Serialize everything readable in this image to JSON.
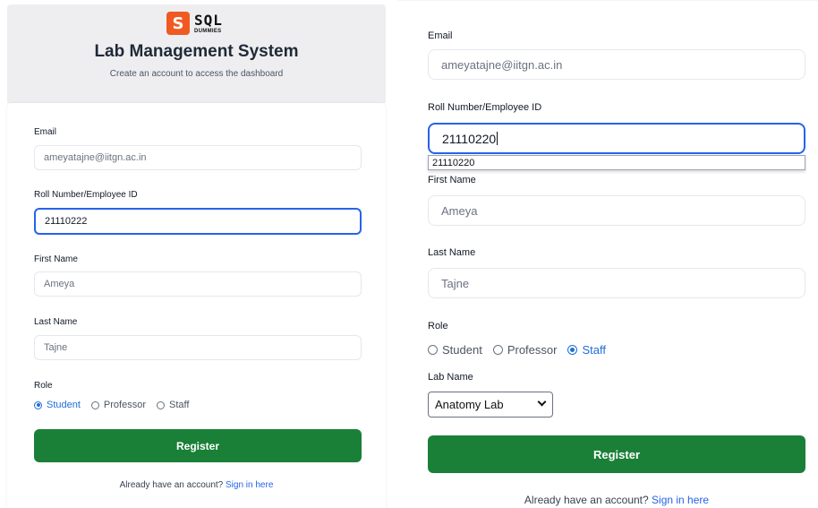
{
  "left": {
    "logo": {
      "badge": "S",
      "brand": "SQL",
      "tagline": "DUMMIES"
    },
    "title": "Lab Management System",
    "subtitle": "Create an account to access the dashboard",
    "email": {
      "label": "Email",
      "placeholder": "ameyatajne@iitgn.ac.in"
    },
    "roll": {
      "label": "Roll Number/Employee ID",
      "value": "21110222"
    },
    "first_name": {
      "label": "First Name",
      "placeholder": "Ameya"
    },
    "last_name": {
      "label": "Last Name",
      "placeholder": "Tajne"
    },
    "role": {
      "label": "Role",
      "options": [
        "Student",
        "Professor",
        "Staff"
      ],
      "selected": "Student"
    },
    "register_label": "Register",
    "footer": {
      "text": "Already have an account?",
      "link": "Sign in here"
    }
  },
  "right": {
    "email": {
      "label": "Email",
      "placeholder": "ameyatajne@iitgn.ac.in"
    },
    "roll": {
      "label": "Roll Number/Employee ID",
      "value": "21110220",
      "suggestion": "21110220"
    },
    "first_name": {
      "label": "First Name",
      "placeholder": "Ameya"
    },
    "last_name": {
      "label": "Last Name",
      "placeholder": "Tajne"
    },
    "role": {
      "label": "Role",
      "options": [
        "Student",
        "Professor",
        "Staff"
      ],
      "selected": "Staff"
    },
    "lab": {
      "label": "Lab Name",
      "selected": "Anatomy Lab"
    },
    "register_label": "Register",
    "footer": {
      "text": "Already have an account?",
      "link": "Sign in here"
    }
  },
  "colors": {
    "accent": "#2563eb",
    "button": "#1a7f37",
    "header_bg": "#eeeef1",
    "logo": "#f05a22"
  },
  "icons": [
    "chevron-down-icon",
    "radio-icon"
  ]
}
